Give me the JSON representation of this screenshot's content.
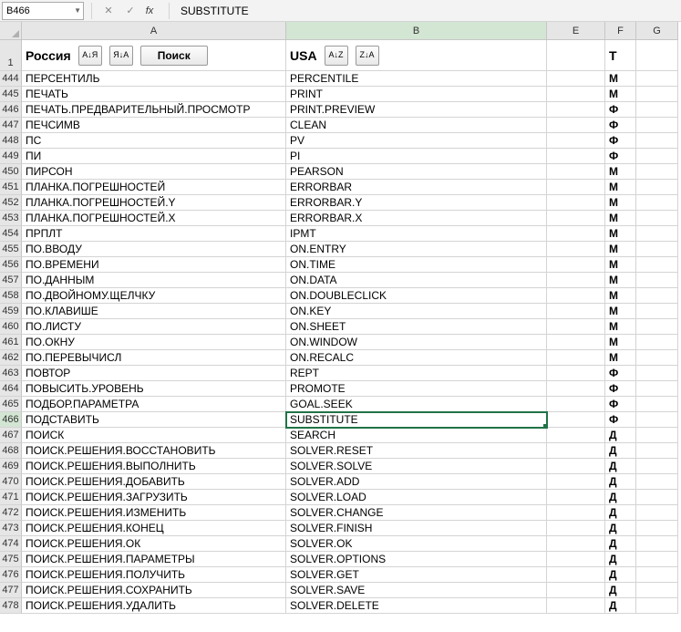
{
  "name_box": "B466",
  "fx_label": "fx",
  "formula_value": "SUBSTITUTE",
  "columns": [
    "A",
    "B",
    "E",
    "F",
    "G"
  ],
  "header_row": {
    "num": "1",
    "a_title": "Россия",
    "a_sort_az": "А↓Я",
    "a_sort_za": "Я↓А",
    "a_search": "Поиск",
    "b_title": "USA",
    "b_sort_az": "A↓Z",
    "b_sort_za": "Z↓A",
    "f_title": "Т"
  },
  "selected_row": 466,
  "rows": [
    {
      "n": 444,
      "a": "ПЕРСЕНТИЛЬ",
      "b": "PERCENTILE",
      "f": "М"
    },
    {
      "n": 445,
      "a": "ПЕЧАТЬ",
      "b": "PRINT",
      "f": "М"
    },
    {
      "n": 446,
      "a": "ПЕЧАТЬ.ПРЕДВАРИТЕЛЬНЫЙ.ПРОСМОТР",
      "b": "PRINT.PREVIEW",
      "f": "Ф"
    },
    {
      "n": 447,
      "a": "ПЕЧСИМВ",
      "b": "CLEAN",
      "f": "Ф"
    },
    {
      "n": 448,
      "a": "ПС",
      "b": "PV",
      "f": "Ф"
    },
    {
      "n": 449,
      "a": "ПИ",
      "b": "PI",
      "f": "Ф"
    },
    {
      "n": 450,
      "a": "ПИРСОН",
      "b": "PEARSON",
      "f": "М"
    },
    {
      "n": 451,
      "a": "ПЛАНКА.ПОГРЕШНОСТЕЙ",
      "b": "ERRORBAR",
      "f": "М"
    },
    {
      "n": 452,
      "a": "ПЛАНКА.ПОГРЕШНОСТЕЙ.Y",
      "b": "ERRORBAR.Y",
      "f": "М"
    },
    {
      "n": 453,
      "a": "ПЛАНКА.ПОГРЕШНОСТЕЙ.X",
      "b": "ERRORBAR.X",
      "f": "М"
    },
    {
      "n": 454,
      "a": "ПРПЛТ",
      "b": "IPMT",
      "f": "М"
    },
    {
      "n": 455,
      "a": "ПО.ВВОДУ",
      "b": "ON.ENTRY",
      "f": "М"
    },
    {
      "n": 456,
      "a": "ПО.ВРЕМЕНИ",
      "b": "ON.TIME",
      "f": "М"
    },
    {
      "n": 457,
      "a": "ПО.ДАННЫМ",
      "b": "ON.DATA",
      "f": "М"
    },
    {
      "n": 458,
      "a": "ПО.ДВОЙНОМУ.ЩЕЛЧКУ",
      "b": "ON.DOUBLECLICK",
      "f": "М"
    },
    {
      "n": 459,
      "a": "ПО.КЛАВИШЕ",
      "b": "ON.KEY",
      "f": "М"
    },
    {
      "n": 460,
      "a": "ПО.ЛИСТУ",
      "b": "ON.SHEET",
      "f": "М"
    },
    {
      "n": 461,
      "a": "ПО.ОКНУ",
      "b": "ON.WINDOW",
      "f": "М"
    },
    {
      "n": 462,
      "a": "ПО.ПЕРЕВЫЧИСЛ",
      "b": "ON.RECALC",
      "f": "М"
    },
    {
      "n": 463,
      "a": "ПОВТОР",
      "b": "REPT",
      "f": "Ф"
    },
    {
      "n": 464,
      "a": "ПОВЫСИТЬ.УРОВЕНЬ",
      "b": "PROMOTE",
      "f": "Ф"
    },
    {
      "n": 465,
      "a": "ПОДБОР.ПАРАМЕТРА",
      "b": "GOAL.SEEK",
      "f": "Ф"
    },
    {
      "n": 466,
      "a": "ПОДСТАВИТЬ",
      "b": "SUBSTITUTE",
      "f": "Ф"
    },
    {
      "n": 467,
      "a": "ПОИСК",
      "b": "SEARCH",
      "f": "Д"
    },
    {
      "n": 468,
      "a": "ПОИСК.РЕШЕНИЯ.ВОССТАНОВИТЬ",
      "b": "SOLVER.RESET",
      "f": "Д"
    },
    {
      "n": 469,
      "a": "ПОИСК.РЕШЕНИЯ.ВЫПОЛНИТЬ",
      "b": "SOLVER.SOLVE",
      "f": "Д"
    },
    {
      "n": 470,
      "a": "ПОИСК.РЕШЕНИЯ.ДОБАВИТЬ",
      "b": "SOLVER.ADD",
      "f": "Д"
    },
    {
      "n": 471,
      "a": "ПОИСК.РЕШЕНИЯ.ЗАГРУЗИТЬ",
      "b": "SOLVER.LOAD",
      "f": "Д"
    },
    {
      "n": 472,
      "a": "ПОИСК.РЕШЕНИЯ.ИЗМЕНИТЬ",
      "b": "SOLVER.CHANGE",
      "f": "Д"
    },
    {
      "n": 473,
      "a": "ПОИСК.РЕШЕНИЯ.КОНЕЦ",
      "b": "SOLVER.FINISH",
      "f": "Д"
    },
    {
      "n": 474,
      "a": "ПОИСК.РЕШЕНИЯ.ОК",
      "b": "SOLVER.OK",
      "f": "Д"
    },
    {
      "n": 475,
      "a": "ПОИСК.РЕШЕНИЯ.ПАРАМЕТРЫ",
      "b": "SOLVER.OPTIONS",
      "f": "Д"
    },
    {
      "n": 476,
      "a": "ПОИСК.РЕШЕНИЯ.ПОЛУЧИТЬ",
      "b": "SOLVER.GET",
      "f": "Д"
    },
    {
      "n": 477,
      "a": "ПОИСК.РЕШЕНИЯ.СОХРАНИТЬ",
      "b": "SOLVER.SAVE",
      "f": "Д"
    },
    {
      "n": 478,
      "a": "ПОИСК.РЕШЕНИЯ.УДАЛИТЬ",
      "b": "SOLVER.DELETE",
      "f": "Д"
    }
  ]
}
